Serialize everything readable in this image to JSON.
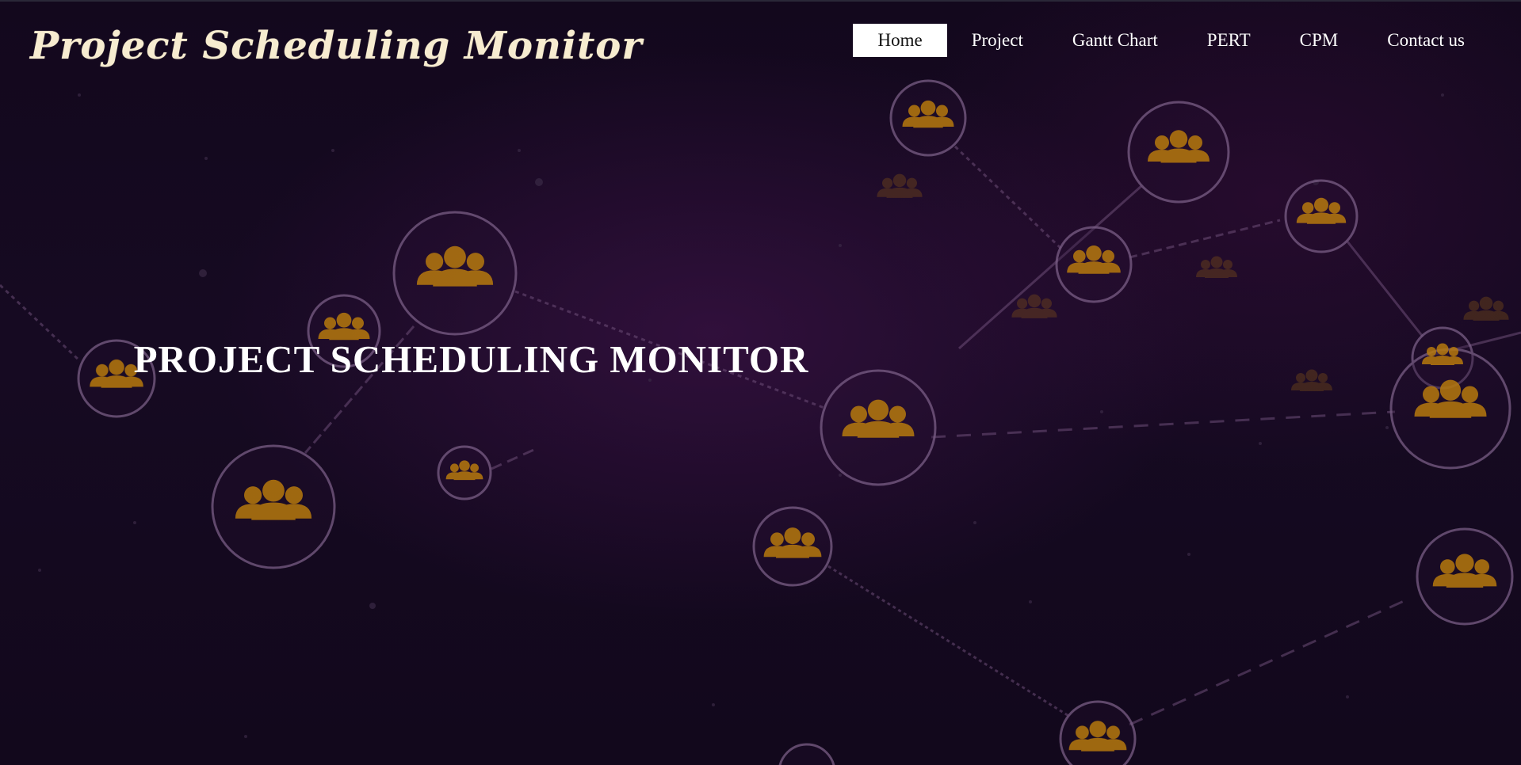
{
  "header": {
    "logo_text": "Project Scheduling Monitor"
  },
  "nav": {
    "items": [
      {
        "label": "Home",
        "active": true
      },
      {
        "label": "Project",
        "active": false
      },
      {
        "label": "Gantt Chart",
        "active": false
      },
      {
        "label": "PERT",
        "active": false
      },
      {
        "label": "CPM",
        "active": false
      },
      {
        "label": "Contact us",
        "active": false
      }
    ]
  },
  "hero": {
    "title": "PROJECT SCHEDULING MONITOR"
  },
  "background": {
    "description_icons": "people-group-icon",
    "colors": {
      "base": "#13081d",
      "node_ring": "#7a5e86",
      "people_icon": "#b87a0e",
      "link_line": "#6e4f78"
    }
  }
}
